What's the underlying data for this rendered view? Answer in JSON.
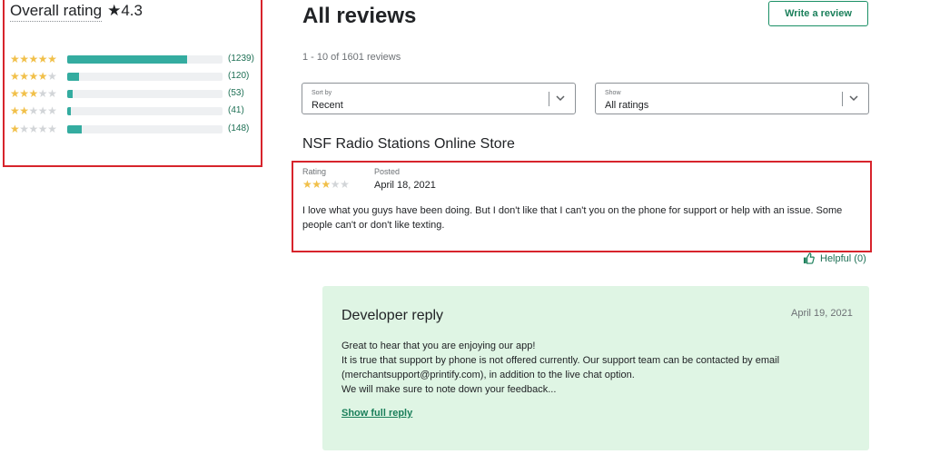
{
  "overall": {
    "label": "Overall rating",
    "score": "★4.3",
    "rows": [
      {
        "stars": 5,
        "fill": 0.774,
        "count": "(1239)"
      },
      {
        "stars": 4,
        "fill": 0.075,
        "count": "(120)"
      },
      {
        "stars": 3,
        "fill": 0.033,
        "count": "(53)"
      },
      {
        "stars": 2,
        "fill": 0.026,
        "count": "(41)"
      },
      {
        "stars": 1,
        "fill": 0.092,
        "count": "(148)"
      }
    ]
  },
  "header": {
    "title": "All reviews",
    "write_button": "Write a review",
    "review_count": "1 - 10 of 1601 reviews"
  },
  "filters": {
    "sort": {
      "label": "Sort by",
      "value": "Recent"
    },
    "show": {
      "label": "Show",
      "value": "All ratings"
    }
  },
  "review": {
    "store": "NSF Radio Stations Online Store",
    "rating_label": "Rating",
    "rating": 3,
    "posted_label": "Posted",
    "posted_date": "April 18, 2021",
    "body": "I love what you guys have been doing. But I don't like that I can't you on the phone for support or help with an issue. Some people can't or don't like texting.",
    "helpful": "Helpful (0)"
  },
  "developer_reply": {
    "title": "Developer reply",
    "date": "April 19, 2021",
    "lines": [
      "Great to hear that you are enjoying our app!",
      "It is true that support by phone is not offered currently. Our support team can be contacted by email",
      "(merchantsupport@printify.com), in addition to the live chat option.",
      "We will make sure to note down your feedback..."
    ],
    "full_reply_link": "Show full reply"
  },
  "colors": {
    "accent": "#1a7f5a",
    "bar": "#34aca0",
    "star": "#f1c04a",
    "highlight": "#d7242c",
    "reply_bg": "#dff5e4"
  }
}
